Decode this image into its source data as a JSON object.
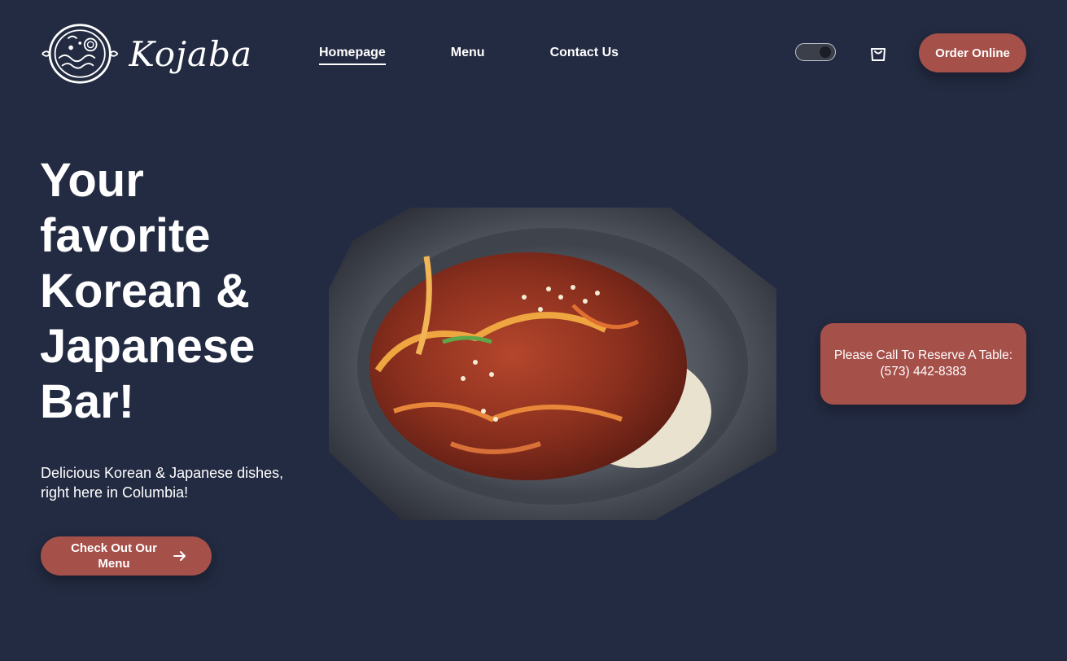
{
  "brand": {
    "name": "Kojaba",
    "logo_icon": "bowl-icon"
  },
  "nav": {
    "items": [
      {
        "label": "Homepage",
        "active": true
      },
      {
        "label": "Menu",
        "active": false
      },
      {
        "label": "Contact Us",
        "active": false
      }
    ]
  },
  "header": {
    "theme_toggle_icon": "toggle-switch-icon",
    "cart_icon": "shopping-bag-icon",
    "order_label": "Order Online"
  },
  "hero": {
    "title_lines": [
      "Your",
      "favorite",
      "Korean &",
      "Japanese",
      "Bar!"
    ],
    "subtitle": "Delicious Korean & Japanese dishes, right here in Columbia!",
    "cta_label": "Check Out Our Menu",
    "cta_icon": "arrow-right-icon"
  },
  "image": {
    "semantic": "stone-bowl-bulgogi-photo"
  },
  "reserve": {
    "line1": "Please Call To Reserve A Table:",
    "phone": "(573) 442-8383"
  },
  "colors": {
    "background": "#232b42",
    "accent": "#a6504a",
    "text": "#ffffff"
  }
}
